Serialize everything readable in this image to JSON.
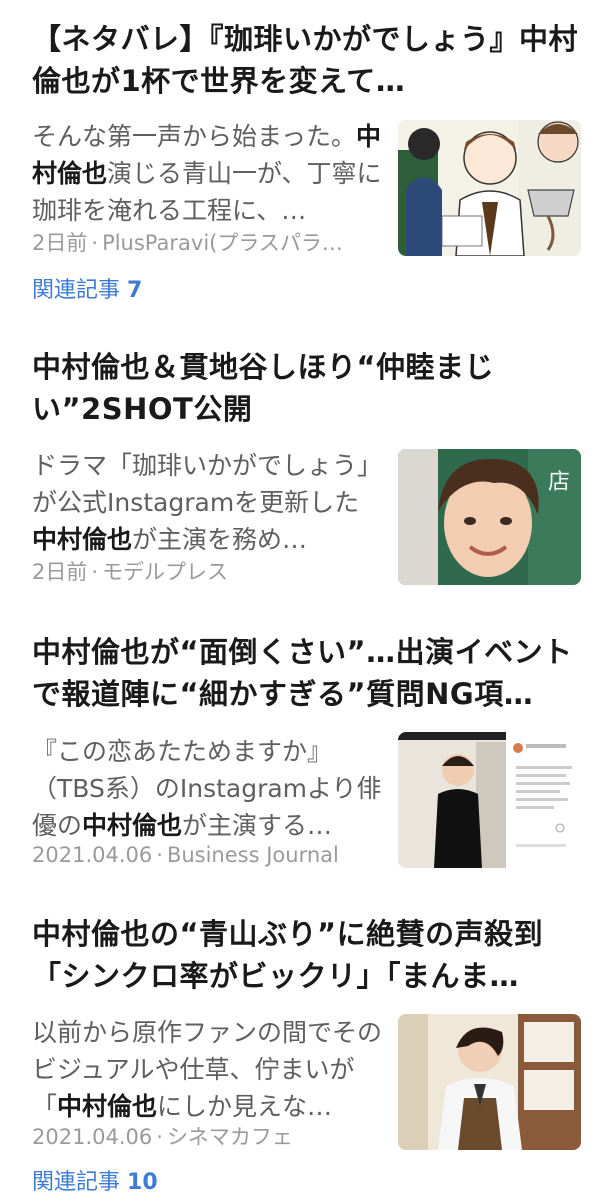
{
  "articles": [
    {
      "title": "【ネタバレ】『珈琲いかがでしょう』中村倫也が1杯で世界を変えて…",
      "snippet_before": "そんな第一声から始まった。",
      "snippet_highlight": "中村倫也",
      "snippet_after": "演じる青山一が、丁寧に珈琲を淹れる工程に、…",
      "time": "2日前",
      "source": "PlusParavi(プラスパラ…",
      "related_label": "関連記事",
      "related_count": "7",
      "thumb_alt": "illustration-thumbnail"
    },
    {
      "title": "中村倫也＆貫地谷しほり“仲睦まじい”2SHOT公開",
      "snippet_before": "ドラマ「珈琲いかがでしょう」が公式Instagramを更新した",
      "snippet_highlight": "中村倫也",
      "snippet_after": "が主演を務め…",
      "time": "2日前",
      "source": "モデルプレス",
      "thumb_alt": "portrait-thumbnail"
    },
    {
      "title": "中村倫也が“面倒くさい”…出演イベントで報道陣に“細かすぎる”質問NG項…",
      "snippet_before": "『この恋あたためますか』（TBS系）のInstagramより俳優の",
      "snippet_highlight": "中村倫也",
      "snippet_after": "が主演する…",
      "time": "2021.04.06",
      "source": "Business Journal",
      "thumb_alt": "instagram-thumbnail"
    },
    {
      "title": "中村倫也の“青山ぶり”に絶賛の声殺到「シンクロ率がビックリ」「まんま…",
      "snippet_before": "以前から原作ファンの間でそのビジュアルや仕草、佇まいが「",
      "snippet_highlight": "中村倫也",
      "snippet_after": "にしか見えな…",
      "time": "2021.04.06",
      "source": "シネマカフェ",
      "related_label": "関連記事",
      "related_count": "10",
      "thumb_alt": "barista-thumbnail"
    }
  ],
  "meta_separator": "·",
  "colors": {
    "link": "#3d7bd6",
    "snippet": "#5f5f5f",
    "meta": "#9a9a9a"
  }
}
